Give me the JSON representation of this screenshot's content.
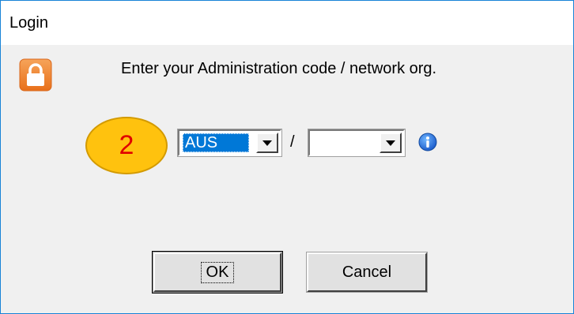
{
  "window": {
    "title": "Login"
  },
  "dialog": {
    "prompt": "Enter your Administration code / network org.",
    "admin_code": {
      "value": "AUS"
    },
    "separator": "/",
    "network_org": {
      "value": ""
    },
    "callout_number": "2",
    "buttons": {
      "ok": "OK",
      "cancel": "Cancel"
    }
  },
  "icons": {
    "lock": "lock-icon",
    "info": "info-icon",
    "dropdown": "chevron-down-icon"
  },
  "colors": {
    "window_border": "#1883d7",
    "dialog_bg": "#f0f0f0",
    "selection": "#0078d7",
    "callout_fill": "#ffc20e",
    "callout_text": "#e00000",
    "lock_icon": "#f28a2a"
  }
}
